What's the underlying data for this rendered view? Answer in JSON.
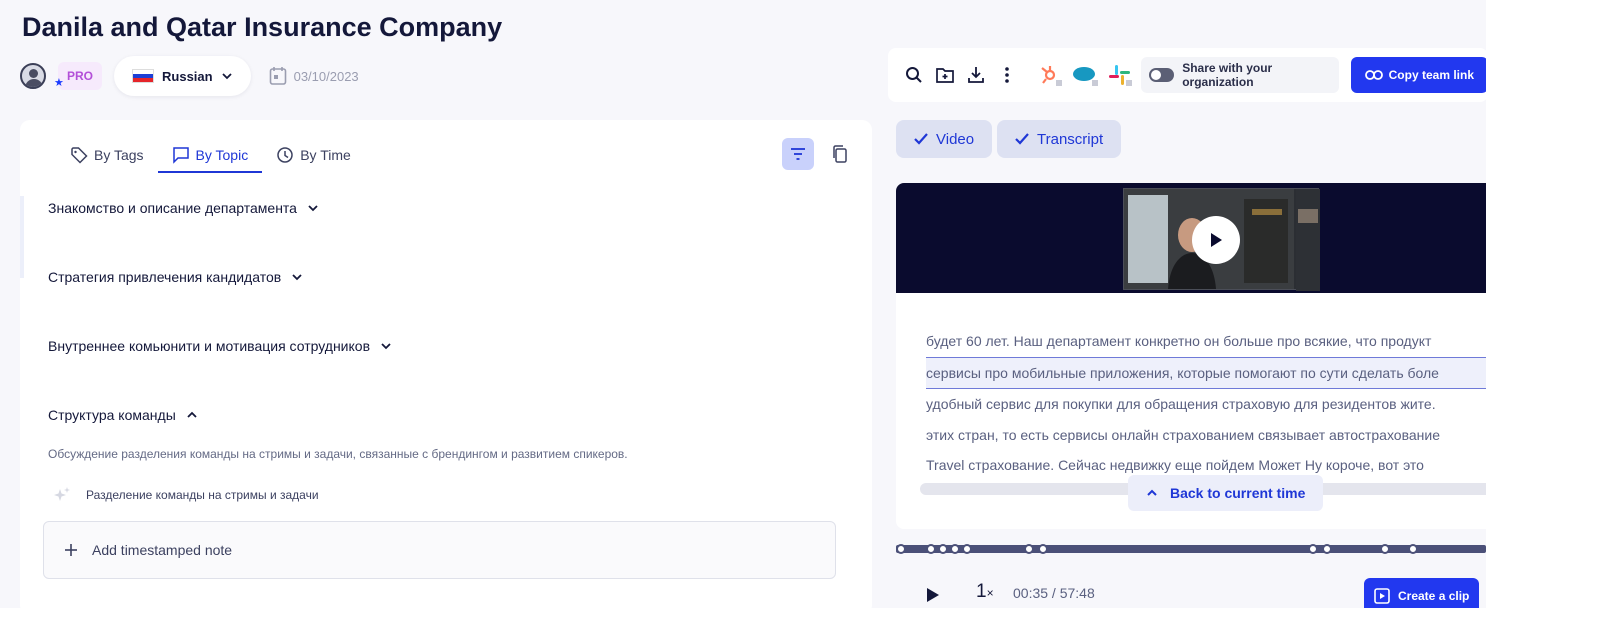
{
  "meeting": {
    "title": "Danila and Qatar Insurance Company",
    "plan_badge": "PRO",
    "language": "Russian",
    "date": "03/10/2023"
  },
  "tabs": [
    {
      "label": "By Tags",
      "icon": "tag-icon"
    },
    {
      "label": "By Topic",
      "icon": "chat-icon",
      "active": true
    },
    {
      "label": "By Time",
      "icon": "clock-icon"
    }
  ],
  "topics": [
    {
      "label": "Знакомство и описание департамента",
      "expanded": false
    },
    {
      "label": "Стратегия привлечения кандидатов",
      "expanded": false
    },
    {
      "label": "Внутреннее комьюнити и мотивация сотрудников",
      "expanded": false
    },
    {
      "label": "Структура команды",
      "expanded": true
    }
  ],
  "expanded_topic": {
    "description": "Обсуждение разделения команды на стримы и задачи, связанные с брендингом и развитием спикеров.",
    "subtopic": "Разделение команды на стримы и задачи"
  },
  "add_note_label": "Add timestamped note",
  "toolbar": {
    "share_label": "Share with your organization",
    "copy_link_label": "Copy team link",
    "icons": [
      "search-icon",
      "folder-add-icon",
      "download-icon",
      "more-vertical-icon"
    ],
    "integrations": [
      "hubspot-icon",
      "salesforce-icon",
      "slack-icon"
    ]
  },
  "filters": {
    "video_label": "Video",
    "transcript_label": "Transcript"
  },
  "transcript": [
    "будет 60 лет. Наш департамент конкретно он больше про всякие, что продукт",
    "сервисы про мобильные приложения, которые помогают по сути сделать боле",
    "удобный сервис для покупки для обращения страховую для резидентов жите.",
    "этих стран, то есть сервисы онлайн страхованием связывает автострахование",
    "Travel страхование. Сейчас недвижку еще пойдем Может Ну короче, вот это"
  ],
  "back_to_current_label": "Back to current time",
  "player": {
    "speed": "1",
    "speed_suffix": "×",
    "current_time": "00:35",
    "duration": "57:48",
    "time_display": "00:35 / 57:48",
    "create_clip_label": "Create a clip"
  },
  "colors": {
    "accent": "#2238ef",
    "accent_text": "#1f37d6",
    "pro_badge_bg": "#f6eafc",
    "pro_badge_text": "#b34fd8",
    "video_bg": "#0a0b2e"
  }
}
